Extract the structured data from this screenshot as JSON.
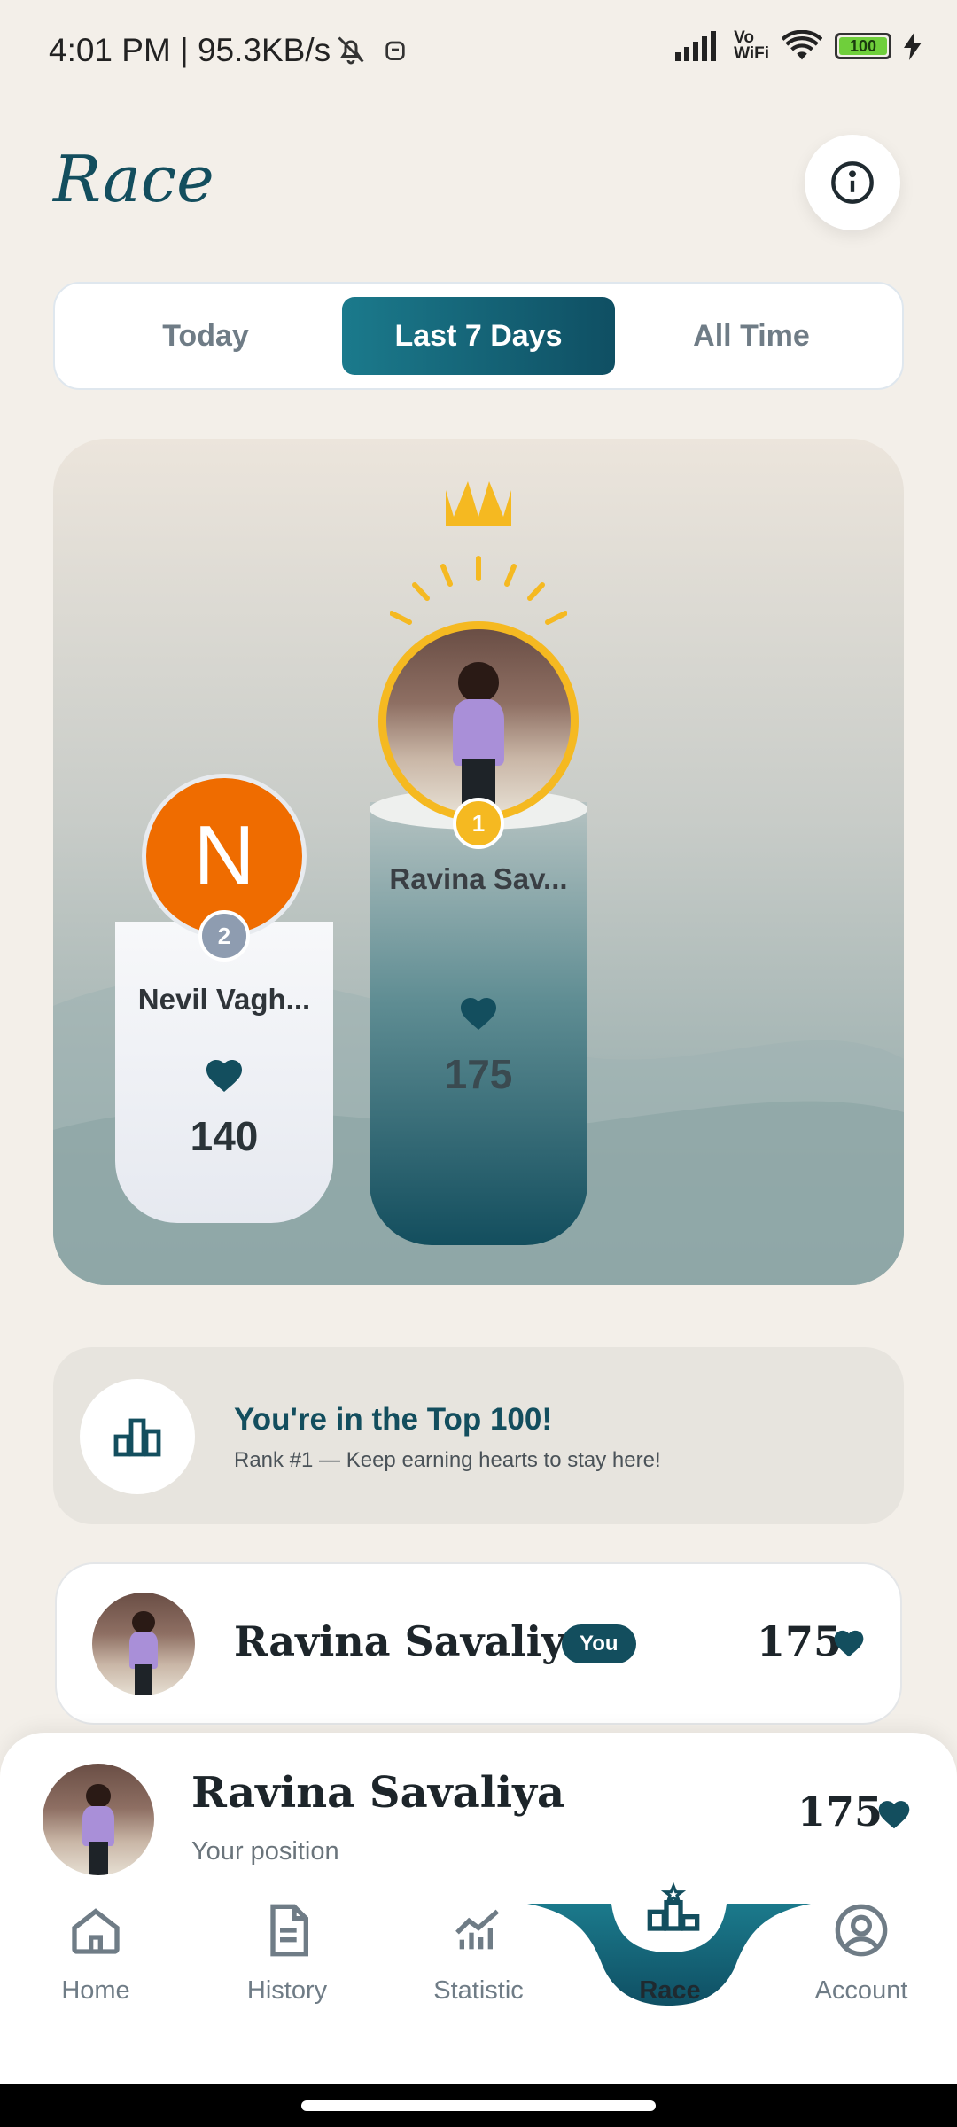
{
  "status_bar": {
    "time": "4:01 PM | 95.3KB/s",
    "battery": "100"
  },
  "header": {
    "title": "Race"
  },
  "tabs": [
    {
      "label": "Today",
      "active": false
    },
    {
      "label": "Last 7 Days",
      "active": true
    },
    {
      "label": "All Time",
      "active": false
    }
  ],
  "podium": {
    "first": {
      "rank": "1",
      "name": "Ravina Sav...",
      "hearts": "175"
    },
    "second": {
      "rank": "2",
      "initial": "N",
      "name": "Nevil Vagh...",
      "hearts": "140"
    }
  },
  "rank_banner": {
    "title": "You're in the Top 100!",
    "subtitle": "Rank #1 — Keep earning hearts to stay here!"
  },
  "leaderboard": [
    {
      "name": "Ravina Savaliya",
      "badge": "You",
      "hearts": "175"
    }
  ],
  "my_position": {
    "name": "Ravina Savaliya",
    "caption": "Your position",
    "hearts": "175"
  },
  "bottom_nav": [
    {
      "label": "Home",
      "icon": "home-icon"
    },
    {
      "label": "History",
      "icon": "document-icon"
    },
    {
      "label": "Statistic",
      "icon": "chart-icon"
    },
    {
      "label": "Race",
      "icon": "podium-icon",
      "active": true
    },
    {
      "label": "Account",
      "icon": "account-icon"
    }
  ],
  "colors": {
    "accent": "#134e5e",
    "accent_light": "#1b7a8c",
    "gold": "#f5b921",
    "silver": "#8e9cb0",
    "orange": "#ef6c00",
    "background": "#f3efe9"
  }
}
